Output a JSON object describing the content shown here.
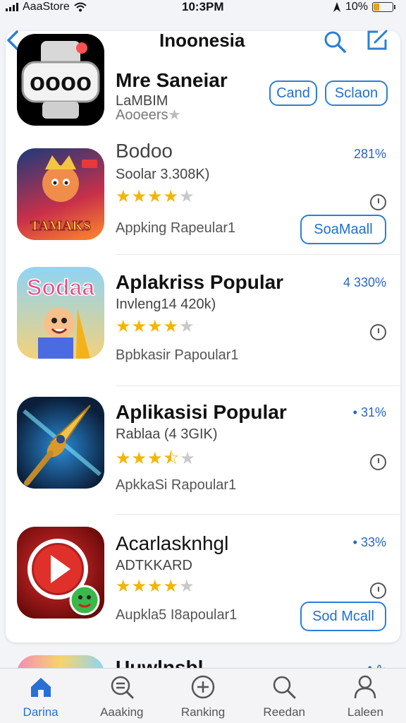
{
  "status": {
    "carrier": "AaaStore",
    "time": "10:3PM",
    "battery": "10%"
  },
  "nav": {
    "title": "Inoonesia"
  },
  "header_app": {
    "name": "Mre Saneiar",
    "sub1": "LaMBIM",
    "sub2": "Aooeers",
    "button_left": "Cand",
    "button_right": "Sclaon"
  },
  "apps": [
    {
      "name": "Bodoo",
      "sub": "Soolar 3.308K)",
      "category": "Appking Rapeular1",
      "percent": "281%",
      "rating": 4,
      "button": "SoaMaall",
      "icon": "tamaks-cartoon-icon"
    },
    {
      "name": "Aplakriss Popular",
      "sub": "Invleng14 420k)",
      "category": "Bpbkasir Papoular1",
      "percent": "4 330%",
      "rating": 4,
      "icon": "sodaa-cartoon-icon"
    },
    {
      "name": "Aplikasisi Popular",
      "sub": "Rablaa (4 3GIK)",
      "category": "ApkkaSi Rapoular1",
      "percent": "• 31%",
      "rating": 3.5,
      "icon": "golden-drill-icon"
    },
    {
      "name": "Acarlasknhgl",
      "sub": "ADTKKARD",
      "category": "Aupkla5 I8apoular1",
      "percent": "• 33%",
      "rating": 4,
      "button": "Sod Mcall",
      "icon": "red-play-icon"
    }
  ],
  "peek": {
    "name": "Uuwlnsbl",
    "percent": "• ∿"
  },
  "tabs": [
    {
      "label": "Darina",
      "icon": "home-icon"
    },
    {
      "label": "Aaaking",
      "icon": "search-list-icon"
    },
    {
      "label": "Ranking",
      "icon": "plus-circle-icon"
    },
    {
      "label": "Reedan",
      "icon": "search-icon"
    },
    {
      "label": "Laleen",
      "icon": "person-icon"
    }
  ],
  "colors": {
    "accent": "#2a7fd6",
    "star": "#f5b400",
    "star_off": "#c9c9c9",
    "battery": "#f0a000"
  }
}
